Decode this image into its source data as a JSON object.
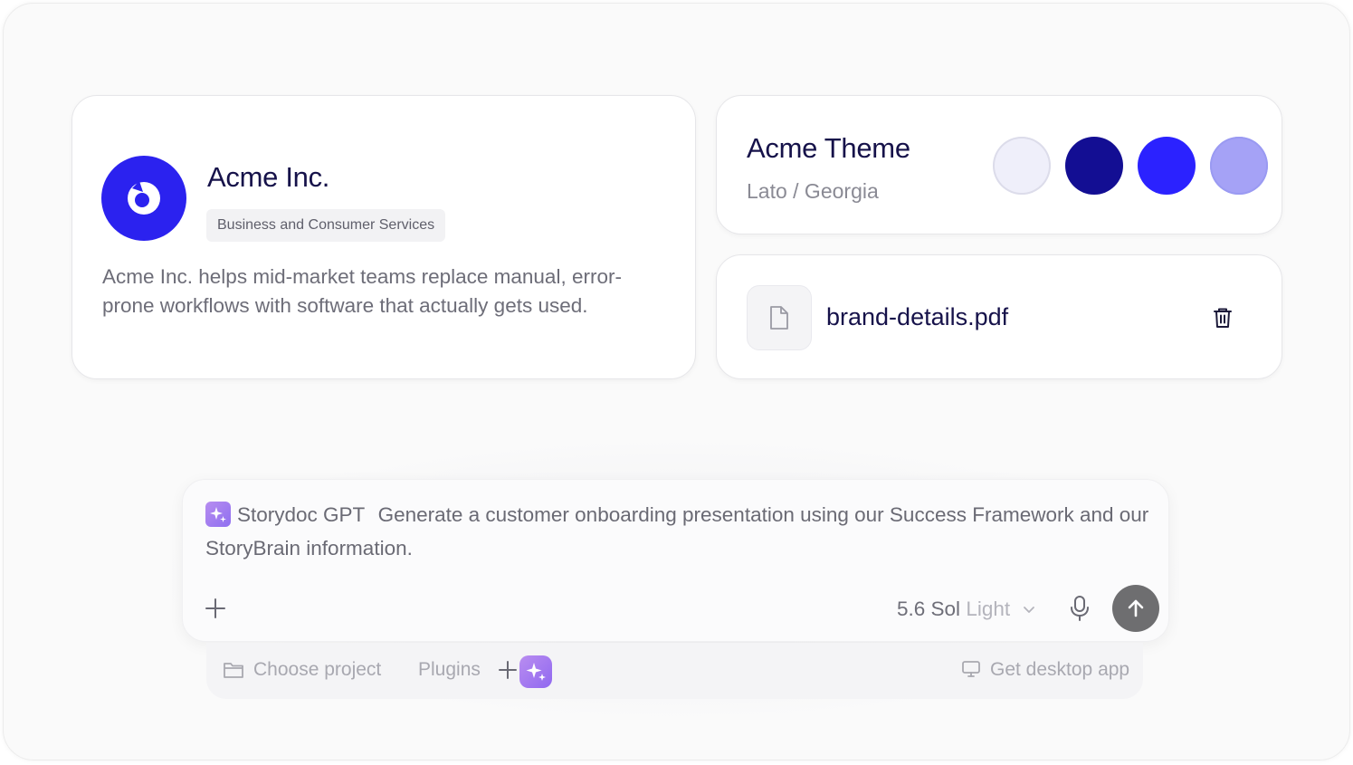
{
  "company": {
    "name": "Acme Inc.",
    "category": "Business and Consumer Services",
    "description": "Acme Inc. helps mid-market teams replace manual, error-prone workflows with software that actually gets used.",
    "logo_icon": "acme-logo-icon",
    "logo_color": "#2b22ef"
  },
  "theme": {
    "title": "Acme Theme",
    "fonts": "Lato / Georgia",
    "swatches": [
      "#efeffa",
      "#130e93",
      "#2b22ff",
      "#a5a2f6"
    ]
  },
  "file": {
    "name": "brand-details.pdf",
    "icon": "file-icon",
    "delete_icon": "trash-icon"
  },
  "prompt": {
    "assistant_name": "Storydoc GPT",
    "text": "Generate a customer onboarding presentation using our Success Framework and our StoryBrain information.",
    "model_version": "5.6 Sol",
    "model_variant": "Light",
    "icons": {
      "add": "plus-icon",
      "mic": "microphone-icon",
      "send": "arrow-up-icon"
    },
    "send_color": "#6e6e70"
  },
  "bottom_bar": {
    "choose_project": "Choose project",
    "plugins": "Plugins",
    "desktop_app": "Get desktop app"
  }
}
